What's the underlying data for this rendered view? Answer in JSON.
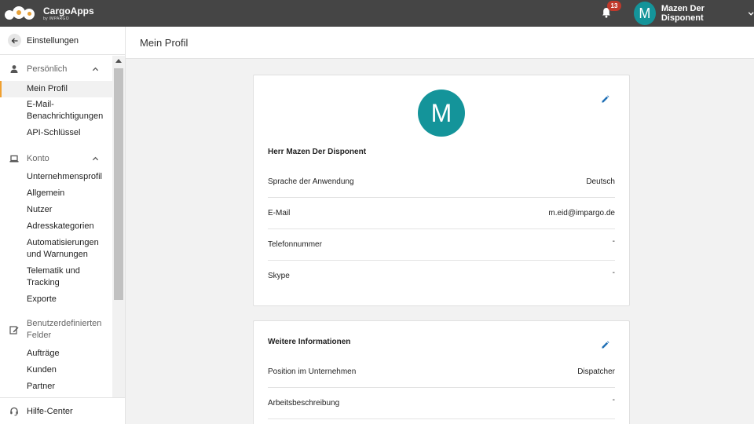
{
  "topbar": {
    "app_title": "CargoApps",
    "app_subtitle": "by IMPARGO",
    "notification_count": "13",
    "user_initial": "M",
    "user_name": "Mazen Der Disponent",
    "icons": {
      "bell": "bell-icon",
      "chevron": "chevron-down-icon"
    }
  },
  "sidebar": {
    "back_label": "Einstellungen",
    "sections": [
      {
        "label": "Persönlich",
        "icon": "person-icon",
        "items": [
          "Mein Profil",
          "E-Mail-Benachrichtigungen",
          "API-Schlüssel"
        ]
      },
      {
        "label": "Konto",
        "icon": "laptop-icon",
        "items": [
          "Unternehmensprofil",
          "Allgemein",
          "Nutzer",
          "Adresskategorien",
          "Automatisierungen und Warnungen",
          "Telematik und Tracking",
          "Exporte"
        ]
      },
      {
        "label": "Benutzerdefinierten Felder",
        "icon": "edit-note-icon",
        "items": [
          "Aufträge",
          "Kunden",
          "Partner"
        ]
      }
    ],
    "active_item": "Mein Profil",
    "help_label": "Hilfe-Center"
  },
  "main": {
    "page_title": "Mein Profil",
    "profile_card": {
      "avatar_initial": "M",
      "full_name": "Herr Mazen Der Disponent",
      "rows": [
        {
          "label": "Sprache der Anwendung",
          "value": "Deutsch"
        },
        {
          "label": "E-Mail",
          "value": "m.eid@impargo.de"
        },
        {
          "label": "Telefonnummer",
          "value": "-"
        },
        {
          "label": "Skype",
          "value": "-"
        }
      ]
    },
    "info_card": {
      "title": "Weitere Informationen",
      "rows": [
        {
          "label": "Position im Unternehmen",
          "value": "Dispatcher"
        },
        {
          "label": "Arbeitsbeschreibung",
          "value": "-"
        }
      ]
    }
  },
  "colors": {
    "topbar": "#454545",
    "accent": "#14949a",
    "badge": "#c0392b",
    "active_marker": "#f0a030",
    "edit_icon": "#1f6fb5"
  }
}
